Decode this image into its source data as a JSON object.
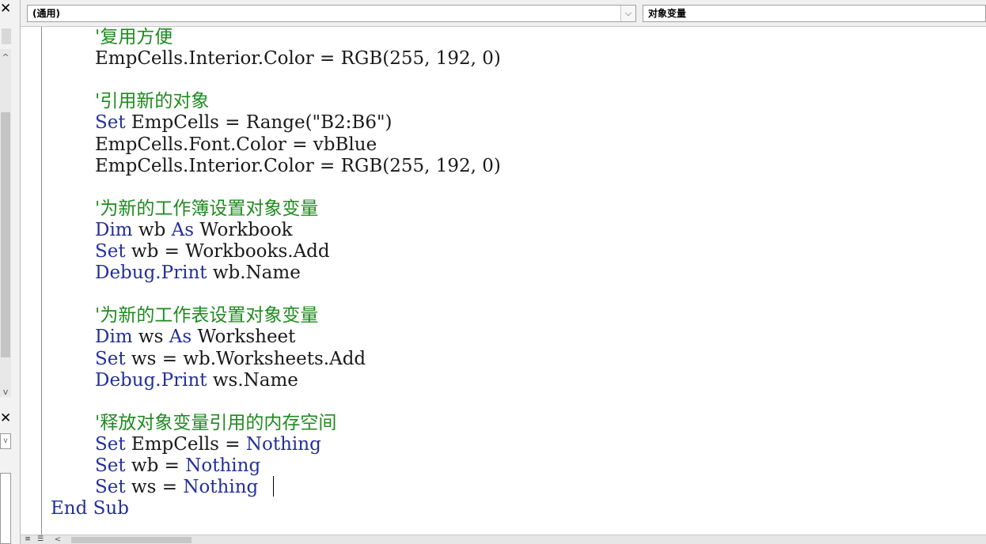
{
  "editor": {
    "object_combo": "(通用)",
    "procedure_combo": "对象变量",
    "dropdown_glyph": "⌵"
  },
  "icons": {
    "close": "✕",
    "up_arrow": "^",
    "down_arrow": "v",
    "scroll_left": "<"
  },
  "code_lines": [
    {
      "type": "comment",
      "text": "'复用方便"
    },
    {
      "type": "code",
      "parts": [
        {
          "t": "EmpCells.Interior.Color = RGB(255, 192, 0)",
          "k": false
        }
      ]
    },
    {
      "type": "blank"
    },
    {
      "type": "comment",
      "text": "'引用新的对象"
    },
    {
      "type": "code",
      "parts": [
        {
          "t": "Set",
          "k": true
        },
        {
          "t": " EmpCells = Range(\"B2:B6\")",
          "k": false
        }
      ]
    },
    {
      "type": "code",
      "parts": [
        {
          "t": "EmpCells.Font.Color = vbBlue",
          "k": false
        }
      ]
    },
    {
      "type": "code",
      "parts": [
        {
          "t": "EmpCells.Interior.Color = RGB(255, 192, 0)",
          "k": false
        }
      ]
    },
    {
      "type": "blank"
    },
    {
      "type": "comment",
      "text": "'为新的工作簿设置对象变量"
    },
    {
      "type": "code",
      "parts": [
        {
          "t": "Dim",
          "k": true
        },
        {
          "t": " wb ",
          "k": false
        },
        {
          "t": "As",
          "k": true
        },
        {
          "t": " Workbook",
          "k": false
        }
      ]
    },
    {
      "type": "code",
      "parts": [
        {
          "t": "Set",
          "k": true
        },
        {
          "t": " wb = Workbooks.Add",
          "k": false
        }
      ]
    },
    {
      "type": "code",
      "parts": [
        {
          "t": "Debug.Print",
          "k": true
        },
        {
          "t": " wb.Name",
          "k": false
        }
      ]
    },
    {
      "type": "blank"
    },
    {
      "type": "comment",
      "text": "'为新的工作表设置对象变量"
    },
    {
      "type": "code",
      "parts": [
        {
          "t": "Dim",
          "k": true
        },
        {
          "t": " ws ",
          "k": false
        },
        {
          "t": "As",
          "k": true
        },
        {
          "t": " Worksheet",
          "k": false
        }
      ]
    },
    {
      "type": "code",
      "parts": [
        {
          "t": "Set",
          "k": true
        },
        {
          "t": " ws = wb.Worksheets.Add",
          "k": false
        }
      ]
    },
    {
      "type": "code",
      "parts": [
        {
          "t": "Debug.Print",
          "k": true
        },
        {
          "t": " ws.Name",
          "k": false
        }
      ]
    },
    {
      "type": "blank"
    },
    {
      "type": "comment",
      "text": "'释放对象变量引用的内存空间"
    },
    {
      "type": "code",
      "parts": [
        {
          "t": "Set",
          "k": true
        },
        {
          "t": " EmpCells = ",
          "k": false
        },
        {
          "t": "Nothing",
          "k": true
        }
      ]
    },
    {
      "type": "code",
      "parts": [
        {
          "t": "Set",
          "k": true
        },
        {
          "t": " wb = ",
          "k": false
        },
        {
          "t": "Nothing",
          "k": true
        }
      ]
    },
    {
      "type": "code",
      "parts": [
        {
          "t": "Set",
          "k": true
        },
        {
          "t": " ws = ",
          "k": false
        },
        {
          "t": "Nothing",
          "k": true
        }
      ]
    },
    {
      "type": "code_outdent",
      "parts": [
        {
          "t": "End Sub",
          "k": true
        }
      ]
    }
  ],
  "colors": {
    "keyword": "#23309a",
    "comment": "#1f8a1f",
    "text": "#1a1a1a"
  }
}
